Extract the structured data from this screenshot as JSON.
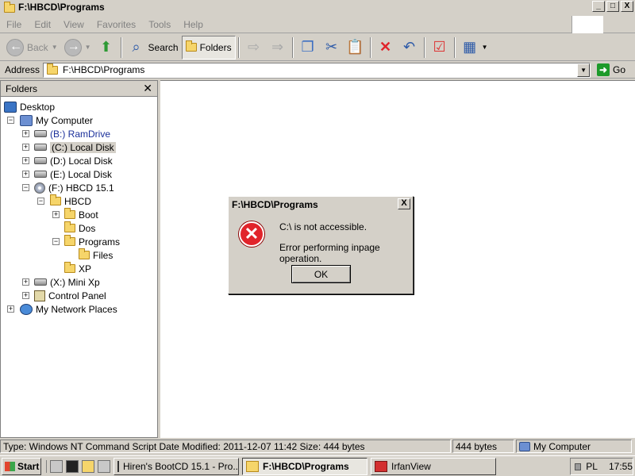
{
  "window": {
    "title": "F:\\HBCD\\Programs",
    "minimize": "_",
    "maximize": "□",
    "close": "X"
  },
  "menu": [
    "File",
    "Edit",
    "View",
    "Favorites",
    "Tools",
    "Help"
  ],
  "toolbar": {
    "back": "Back",
    "search": "Search",
    "folders": "Folders"
  },
  "address": {
    "label": "Address",
    "value": "F:\\HBCD\\Programs",
    "go": "Go"
  },
  "folders_pane": {
    "title": "Folders",
    "close": "✕",
    "items": [
      {
        "label": "Desktop",
        "icon": "desktop-icon"
      },
      {
        "label": "My Computer",
        "icon": "computer-icon",
        "expander": "−"
      },
      {
        "label": "(B:) RamDrive",
        "icon": "drive-icon",
        "expander": "+"
      },
      {
        "label": "(C:) Local Disk",
        "icon": "drive-icon",
        "expander": "+"
      },
      {
        "label": "(D:) Local Disk",
        "icon": "drive-icon",
        "expander": "+"
      },
      {
        "label": "(E:) Local Disk",
        "icon": "drive-icon",
        "expander": "+"
      },
      {
        "label": "(F:) HBCD 15.1",
        "icon": "cd-icon",
        "expander": "−"
      },
      {
        "label": "HBCD",
        "icon": "folder-icon",
        "expander": "−"
      },
      {
        "label": "Boot",
        "icon": "folder-icon",
        "expander": "+"
      },
      {
        "label": "Dos",
        "icon": "folder-icon"
      },
      {
        "label": "Programs",
        "icon": "folder-icon",
        "expander": "−"
      },
      {
        "label": "Files",
        "icon": "folder-icon"
      },
      {
        "label": "XP",
        "icon": "folder-icon"
      },
      {
        "label": "(X:) Mini Xp",
        "icon": "drive-icon",
        "expander": "+"
      },
      {
        "label": "Control Panel",
        "icon": "control-panel-icon",
        "expander": "+"
      },
      {
        "label": "My Network Places",
        "icon": "network-icon",
        "expander": "+"
      }
    ]
  },
  "dialog": {
    "title": "F:\\HBCD\\Programs",
    "close": "X",
    "icon_glyph": "✕",
    "message1": "C:\\ is not accessible.",
    "message2": "Error performing inpage operation.",
    "ok": "OK"
  },
  "status": {
    "info": "Type: Windows NT Command Script Date Modified: 2011-12-07 11:42 Size: 444 bytes",
    "size": "444 bytes",
    "location": "My Computer"
  },
  "taskbar": {
    "start": "Start",
    "tasks": [
      "Hiren's BootCD 15.1 - Pro...",
      "F:\\HBCD\\Programs",
      "IrfanView"
    ],
    "lang": "PL",
    "clock": "17:55"
  },
  "colors": {
    "error_red": "#e1242b",
    "go_green": "#1d9a2a"
  }
}
